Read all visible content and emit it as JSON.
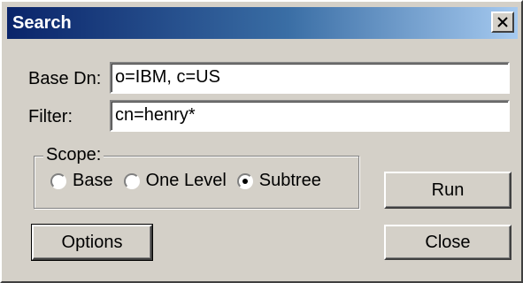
{
  "window": {
    "title": "Search",
    "close_glyph": "✕"
  },
  "form": {
    "base_dn_label": "Base Dn:",
    "base_dn_value": "o=IBM, c=US",
    "filter_label": "Filter:",
    "filter_value": "cn=henry*"
  },
  "scope": {
    "legend": "Scope:",
    "options": [
      {
        "label": "Base",
        "selected": false
      },
      {
        "label": "One Level",
        "selected": false
      },
      {
        "label": "Subtree",
        "selected": true
      }
    ]
  },
  "buttons": {
    "run": "Run",
    "options": "Options",
    "close": "Close"
  },
  "colors": {
    "titlebar_start": "#0a246a",
    "titlebar_end": "#a6caf0",
    "face": "#d4d0c8"
  }
}
